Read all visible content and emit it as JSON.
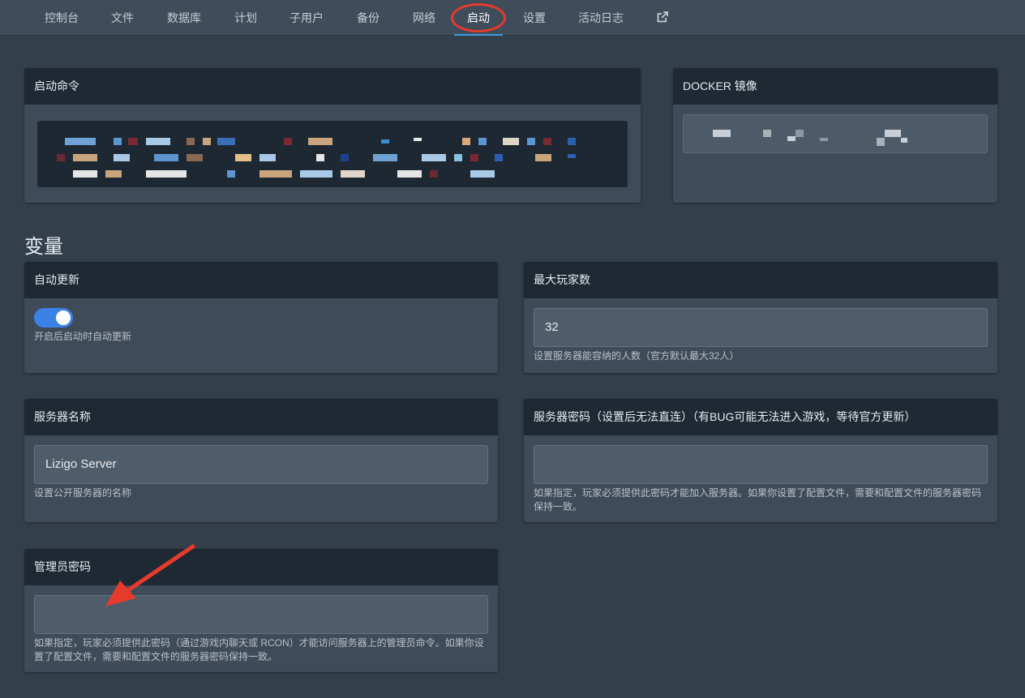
{
  "nav": {
    "items": [
      "控制台",
      "文件",
      "数据库",
      "计划",
      "子用户",
      "备份",
      "网络",
      "启动",
      "设置",
      "活动日志"
    ],
    "active": "启动",
    "external_icon": "external-link-icon"
  },
  "startup": {
    "command_title": "启动命令",
    "docker_title": "DOCKER 镜像"
  },
  "variables": {
    "section_title": "变量",
    "auto_update": {
      "title": "自动更新",
      "enabled": true,
      "hint": "开启后启动时自动更新"
    },
    "max_players": {
      "title": "最大玩家数",
      "value": "32",
      "hint": "设置服务器能容纳的人数（官方默认最大32人）"
    },
    "server_name": {
      "title": "服务器名称",
      "value": "Lizigo Server",
      "hint": "设置公开服务器的名称"
    },
    "server_password": {
      "title": "服务器密码（设置后无法直连）（有BUG可能无法进入游戏，等待官方更新）",
      "value": "",
      "hint": "如果指定，玩家必须提供此密码才能加入服务器。如果你设置了配置文件，需要和配置文件的服务器密码保持一致。"
    },
    "admin_password": {
      "title": "管理员密码",
      "value": "",
      "hint": "如果指定，玩家必须提供此密码（通过游戏内聊天或 RCON）才能访问服务器上的管理员命令。如果你设置了配置文件，需要和配置文件的服务器密码保持一致。"
    }
  },
  "colors": {
    "active_tab": "#3f9bd8",
    "toggle_on": "#3b82e6",
    "annotation_red": "#e53b2c"
  }
}
